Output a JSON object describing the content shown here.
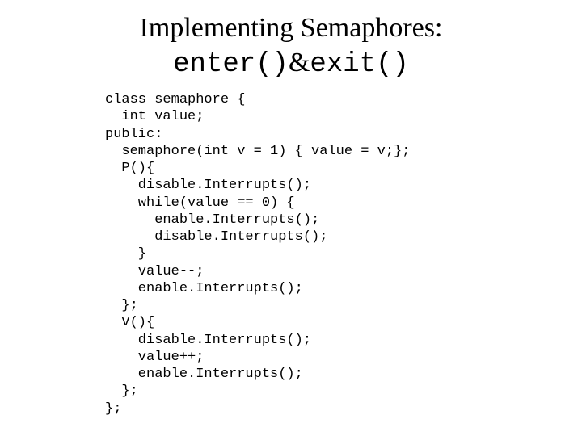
{
  "title": {
    "line1": "Implementing Semaphores:",
    "line2_left": "enter()",
    "line2_amp": "&",
    "line2_right": "exit()"
  },
  "code": "class semaphore {\n  int value;\npublic:\n  semaphore(int v = 1) { value = v;};\n  P(){\n    disable.Interrupts();\n    while(value == 0) {\n      enable.Interrupts();\n      disable.Interrupts();\n    }\n    value--;\n    enable.Interrupts();\n  };\n  V(){\n    disable.Interrupts();\n    value++;\n    enable.Interrupts();\n  };\n};"
}
